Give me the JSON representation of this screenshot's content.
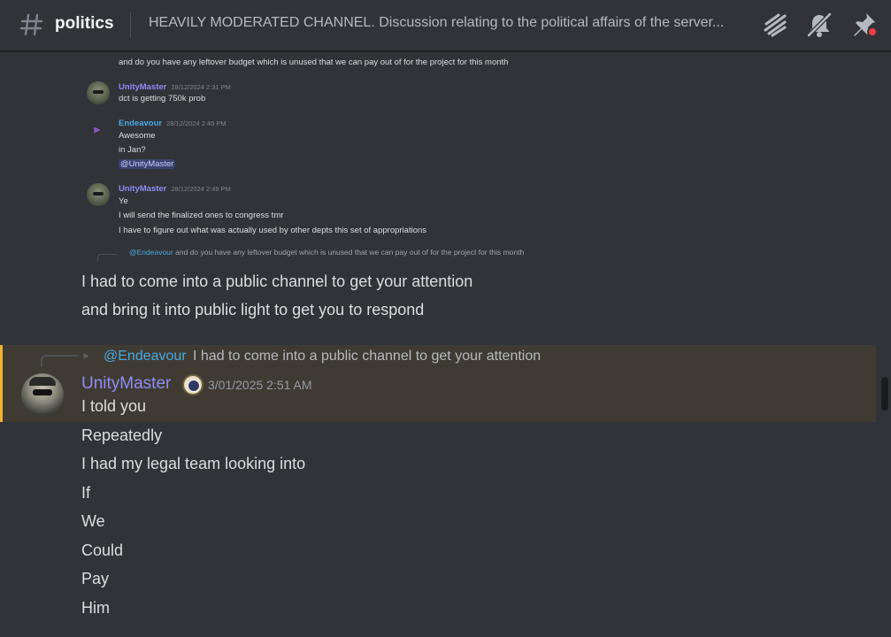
{
  "header": {
    "channel_name": "politics",
    "topic": "HEAVILY MODERATED CHANNEL. Discussion relating to the political affairs of the server..."
  },
  "embedded_screenshot": {
    "top_line": "and do you have any leftover budget which is unused that we can pay out of for the project for this month",
    "messages": [
      {
        "author": "UnityMaster",
        "timestamp": "28/12/2024 2:31 PM",
        "lines": [
          "dct is getting 750k prob"
        ]
      },
      {
        "author": "Endeavour",
        "timestamp": "28/12/2024 2:45 PM",
        "lines": [
          "Awesome",
          "in Jan?"
        ],
        "mention": "@UnityMaster"
      },
      {
        "author": "UnityMaster",
        "timestamp": "28/12/2024 2:49 PM",
        "lines": [
          "Ye",
          "I will send the finalized ones to congress tmr",
          "I have to figure out what was actually used by other depts this set of appropriations"
        ]
      }
    ],
    "reply_mention": "@Endeavour",
    "reply_text": "and do you have any leftover budget which is unused that we can pay out of for the project for this month"
  },
  "prior_message": {
    "lines": [
      "I had to come into a public channel to get your attention",
      "and bring it into public light to get you to respond"
    ]
  },
  "highlighted_message": {
    "reply_mention": "@Endeavour",
    "reply_text": "I had to come into a public channel to get your attention",
    "author": "UnityMaster",
    "timestamp": "3/01/2025 2:51 AM",
    "lines": [
      "I told you",
      "Repeatedly",
      "I had my legal team looking into",
      "If",
      "We",
      "Could",
      "Pay",
      "Him"
    ]
  },
  "colors": {
    "background": "#313338",
    "highlight_background": "#3f3b33",
    "highlight_bar": "#f0b232",
    "username": "#8e8cf5",
    "mention": "#4aa8e0"
  },
  "icons": [
    "hash-icon",
    "threads-icon",
    "mute-bell-icon",
    "pin-icon",
    "reply-arrow-icon",
    "server-badge-icon"
  ]
}
